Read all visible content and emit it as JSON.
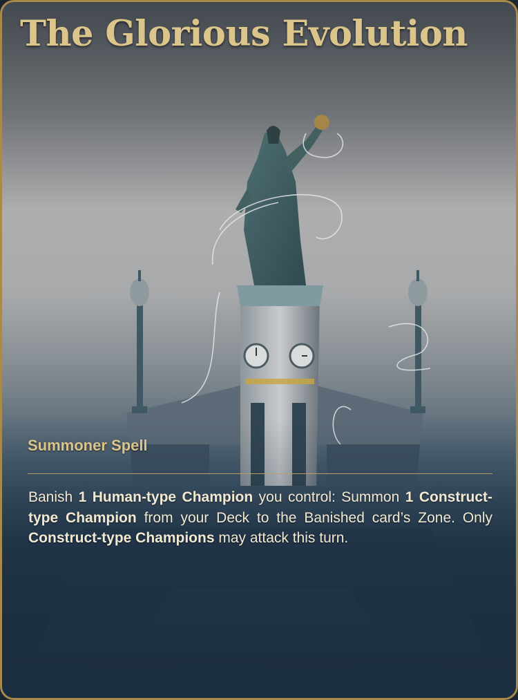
{
  "card": {
    "title": "The Glorious Evolution",
    "type_line": "Summoner Spell",
    "rules_text": [
      {
        "text": "Banish ",
        "bold": false
      },
      {
        "text": "1 Human-type Champion",
        "bold": true
      },
      {
        "text": " you control: Summon ",
        "bold": false
      },
      {
        "text": "1 Construct-type Champion",
        "bold": true
      },
      {
        "text": " from your Deck to the Banished card’s Zone. Only ",
        "bold": false
      },
      {
        "text": "Construct-type Champions",
        "bold": true
      },
      {
        "text": " may attack this turn.",
        "bold": false
      }
    ]
  },
  "colors": {
    "frame_border": "#a88a4a",
    "title_gold": "#dcc58a",
    "rules_text": "#f1e9d2",
    "background_dark": "#1b2d40"
  }
}
